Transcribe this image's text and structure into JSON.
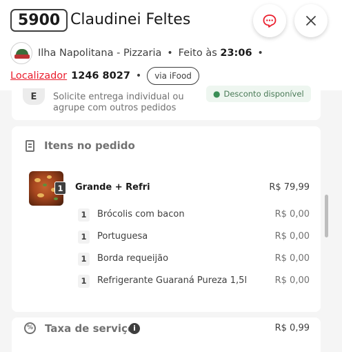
{
  "header": {
    "order_number": "5900",
    "customer_name": "Claudinei Feltes",
    "store_name": "Ilha Napolitana - Pizzaria",
    "placed_prefix": "Feito às",
    "placed_time": "23:06",
    "locator_label": "Localizador",
    "locator_code": "1246 8027",
    "channel_chip": "via iFood"
  },
  "delivery": {
    "icon": "delivery-icon",
    "text": "Solicite entrega individual ou agrupe com outros pedidos",
    "discount_badge": "Desconto disponível"
  },
  "items": {
    "title": "Itens no pedido",
    "product": {
      "quantity": "1",
      "name": "Grande + Refri",
      "price": "R$ 79,99"
    },
    "sub_items": [
      {
        "quantity": "1",
        "name": "Brócolis com bacon",
        "price": "R$ 0,00"
      },
      {
        "quantity": "1",
        "name": "Portuguesa",
        "price": "R$ 0,00"
      },
      {
        "quantity": "1",
        "name": "Borda requeijão",
        "price": "R$ 0,00"
      },
      {
        "quantity": "1",
        "name": "Refrigerante Guaraná Pureza 1,5l",
        "price": "R$ 0,00"
      }
    ]
  },
  "fees": {
    "service_fee_label": "Taxa de serviço",
    "service_fee_price": "R$ 0,99",
    "info_glyph": "i"
  },
  "colors": {
    "accent_red": "#ea1d2c",
    "discount_green": "#3b8f57",
    "text_dark": "#3e3e3e"
  }
}
